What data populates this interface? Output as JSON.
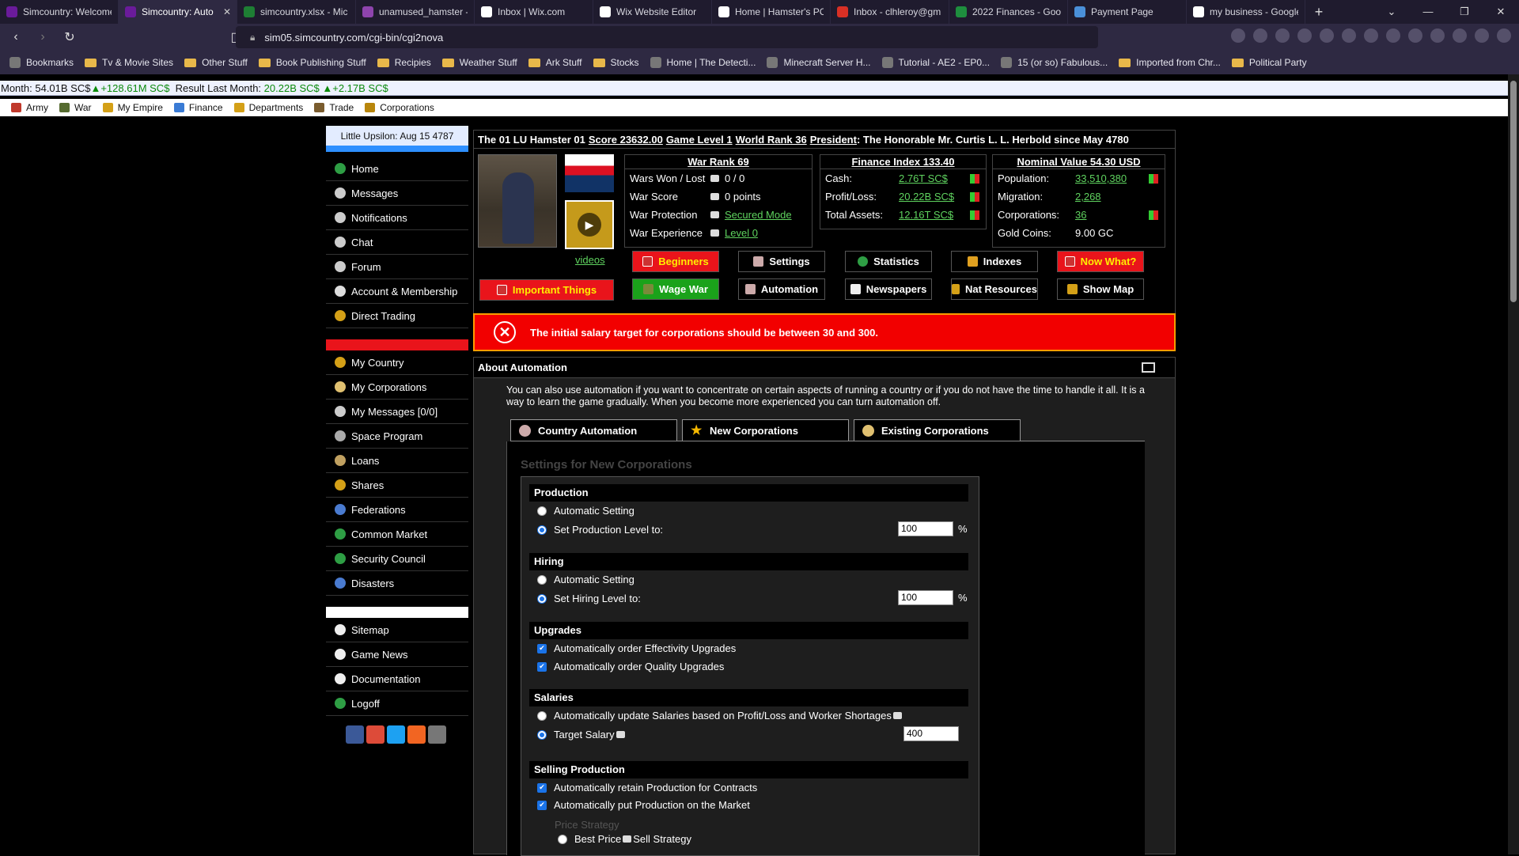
{
  "browser": {
    "tabs": [
      {
        "label": "Simcountry: Welcome",
        "color": "#6a1b9a",
        "active": false
      },
      {
        "label": "Simcountry: Auto",
        "color": "#6a1b9a",
        "active": true
      },
      {
        "label": "simcountry.xlsx - Mic",
        "color": "#1e7e34",
        "active": false
      },
      {
        "label": "unamused_hamster -",
        "color": "#8e44ad",
        "active": false
      },
      {
        "label": "Inbox | Wix.com",
        "color": "#ffffff",
        "active": false
      },
      {
        "label": "Wix Website Editor",
        "color": "#ffffff",
        "active": false
      },
      {
        "label": "Home | Hamster's PC",
        "color": "#ffffff",
        "active": false
      },
      {
        "label": "Inbox - clhleroy@gm",
        "color": "#d93025",
        "active": false
      },
      {
        "label": "2022 Finances - Goo",
        "color": "#1e8e3e",
        "active": false
      },
      {
        "label": "Payment Page",
        "color": "#4a90d9",
        "active": false
      },
      {
        "label": "my business - Google",
        "color": "#ffffff",
        "active": false
      }
    ],
    "url": "sim05.simcountry.com/cgi-bin/cgi2nova",
    "bookmarks": [
      {
        "label": "Bookmarks",
        "type": "fav"
      },
      {
        "label": "Tv & Movie Sites",
        "type": "folder"
      },
      {
        "label": "Other Stuff",
        "type": "folder"
      },
      {
        "label": "Book Publishing Stuff",
        "type": "folder"
      },
      {
        "label": "Recipies",
        "type": "folder"
      },
      {
        "label": "Weather Stuff",
        "type": "folder"
      },
      {
        "label": "Ark Stuff",
        "type": "folder"
      },
      {
        "label": "Stocks",
        "type": "folder"
      },
      {
        "label": "Home | The Detecti...",
        "type": "fav"
      },
      {
        "label": "Minecraft Server H...",
        "type": "fav"
      },
      {
        "label": "Tutorial - AE2 - EP0...",
        "type": "fav"
      },
      {
        "label": "15 (or so) Fabulous...",
        "type": "fav"
      },
      {
        "label": "Imported from Chr...",
        "type": "folder"
      },
      {
        "label": "Political Party",
        "type": "folder"
      }
    ]
  },
  "infostrip": {
    "part1": "Month: 54.01B SC$ ",
    "part2": "▲+128.61M SC$",
    "part3": "  Result Last Month: ",
    "part4": "20.22B SC$ ▲+2.17B SC$"
  },
  "menustrip": [
    {
      "label": "Army",
      "color": "#c0392b"
    },
    {
      "label": "War",
      "color": "#556b2f"
    },
    {
      "label": "My Empire",
      "color": "#d4a017"
    },
    {
      "label": "Finance",
      "color": "#3a7bd5"
    },
    {
      "label": "Departments",
      "color": "#d4a017"
    },
    {
      "label": "Trade",
      "color": "#7a5c2e"
    },
    {
      "label": "Corporations",
      "color": "#b8860b"
    }
  ],
  "leftnav": {
    "date": "Little Upsilon: Aug 15 4787",
    "group1": [
      {
        "label": "Home",
        "color": "#2e9e44"
      },
      {
        "label": "Messages",
        "color": "#cccccc"
      },
      {
        "label": "Notifications",
        "color": "#cccccc"
      },
      {
        "label": "Chat",
        "color": "#cccccc"
      },
      {
        "label": "Forum",
        "color": "#cccccc"
      },
      {
        "label": "Account & Membership",
        "color": "#dddddd"
      },
      {
        "label": "Direct Trading",
        "color": "#d4a017"
      }
    ],
    "group2": [
      {
        "label": "My Country",
        "color": "#d4a017"
      },
      {
        "label": "My Corporations",
        "color": "#e0c070"
      },
      {
        "label": "My Messages [0/0]",
        "color": "#cccccc"
      },
      {
        "label": "Space Program",
        "color": "#aaaaaa"
      },
      {
        "label": "Loans",
        "color": "#c0a060"
      },
      {
        "label": "Shares",
        "color": "#d4a017"
      },
      {
        "label": "Federations",
        "color": "#4a7bd0"
      },
      {
        "label": "Common Market",
        "color": "#2e9e44"
      },
      {
        "label": "Security Council",
        "color": "#2e9e44"
      },
      {
        "label": "Disasters",
        "color": "#4a7bd0"
      }
    ],
    "group3": [
      {
        "label": "Sitemap",
        "color": "#eeeeee"
      },
      {
        "label": "Game News",
        "color": "#eeeeee"
      },
      {
        "label": "Documentation",
        "color": "#eeeeee"
      },
      {
        "label": "Logoff",
        "color": "#2e9e44"
      }
    ],
    "social": [
      {
        "name": "facebook-icon",
        "color": "#3b5998"
      },
      {
        "name": "google-plus-icon",
        "color": "#dd4b39"
      },
      {
        "name": "twitter-icon",
        "color": "#1da1f2"
      },
      {
        "name": "rss-icon",
        "color": "#f26522"
      },
      {
        "name": "email-icon",
        "color": "#777777"
      }
    ]
  },
  "title": {
    "country": "The 01 LU Hamster 01",
    "score": "Score 23632.00",
    "level": "Game Level 1",
    "rank": "World Rank 36",
    "president_label": "President",
    "president": ": The Honorable Mr. Curtis L. L. Herbold since May 4780"
  },
  "war": {
    "header": "War Rank 69",
    "rows": [
      {
        "label": "Wars Won / Lost",
        "value": "0 / 0",
        "link": false
      },
      {
        "label": "War Score",
        "value": "0 points",
        "link": false
      },
      {
        "label": "War Protection",
        "value": "Secured Mode",
        "link": true
      },
      {
        "label": "War Experience",
        "value": "Level 0",
        "link": true
      }
    ]
  },
  "finance": {
    "header": "Finance Index 133.40",
    "rows": [
      {
        "label": "Cash:",
        "value": "2.76T SC$"
      },
      {
        "label": "Profit/Loss:",
        "value": "20.22B SC$"
      },
      {
        "label": "Total Assets:",
        "value": "12.16T SC$"
      }
    ]
  },
  "nominal": {
    "header": "Nominal Value 54.30 USD",
    "rows": [
      {
        "label": "Population:",
        "value": "33,510,380",
        "link": true,
        "flag": true
      },
      {
        "label": "Migration:",
        "value": "2,268",
        "link": true,
        "flag": false
      },
      {
        "label": "Corporations:",
        "value": "36",
        "link": true,
        "flag": true
      },
      {
        "label": "Gold Coins:",
        "value": "9.00 GC",
        "link": false,
        "flag": false
      }
    ]
  },
  "videos_label": "videos",
  "buttons": {
    "beginners": "Beginners",
    "settings": "Settings",
    "statistics": "Statistics",
    "indexes": "Indexes",
    "now_what": "Now What?",
    "important": "Important Things",
    "wage_war": "Wage War",
    "automation": "Automation",
    "newspapers": "Newspapers",
    "nat_resources": "Nat Resources",
    "show_map": "Show Map"
  },
  "error": "The initial salary target for corporations should be between 30 and 300.",
  "about": {
    "heading": "About Automation",
    "text": "You can also use automation if you want to concentrate on certain aspects of running a country or if you do not have the time to handle it all. It is a way to learn the game gradually. When you become more experienced you can turn automation off.",
    "tabs": [
      "Country Automation",
      "New Corporations",
      "Existing Corporations"
    ],
    "settings_title": "Settings for New Corporations",
    "production": {
      "head": "Production",
      "auto": "Automatic Setting",
      "set": "Set Production Level to:",
      "value": "100",
      "unit": "%"
    },
    "hiring": {
      "head": "Hiring",
      "auto": "Automatic Setting",
      "set": "Set Hiring Level to:",
      "value": "100",
      "unit": "%"
    },
    "upgrades": {
      "head": "Upgrades",
      "opt1": "Automatically order Effectivity Upgrades",
      "opt2": "Automatically order Quality Upgrades"
    },
    "salaries": {
      "head": "Salaries",
      "opt1": "Automatically update Salaries based on Profit/Loss and Worker Shortages",
      "opt2": "Target Salary",
      "value": "400"
    },
    "selling": {
      "head": "Selling Production",
      "opt1": "Automatically retain Production for Contracts",
      "opt2": "Automatically put Production on the Market",
      "price_strategy": "Price Strategy",
      "best_price": "Best Price",
      "sell_strategy": "Sell Strategy"
    }
  }
}
